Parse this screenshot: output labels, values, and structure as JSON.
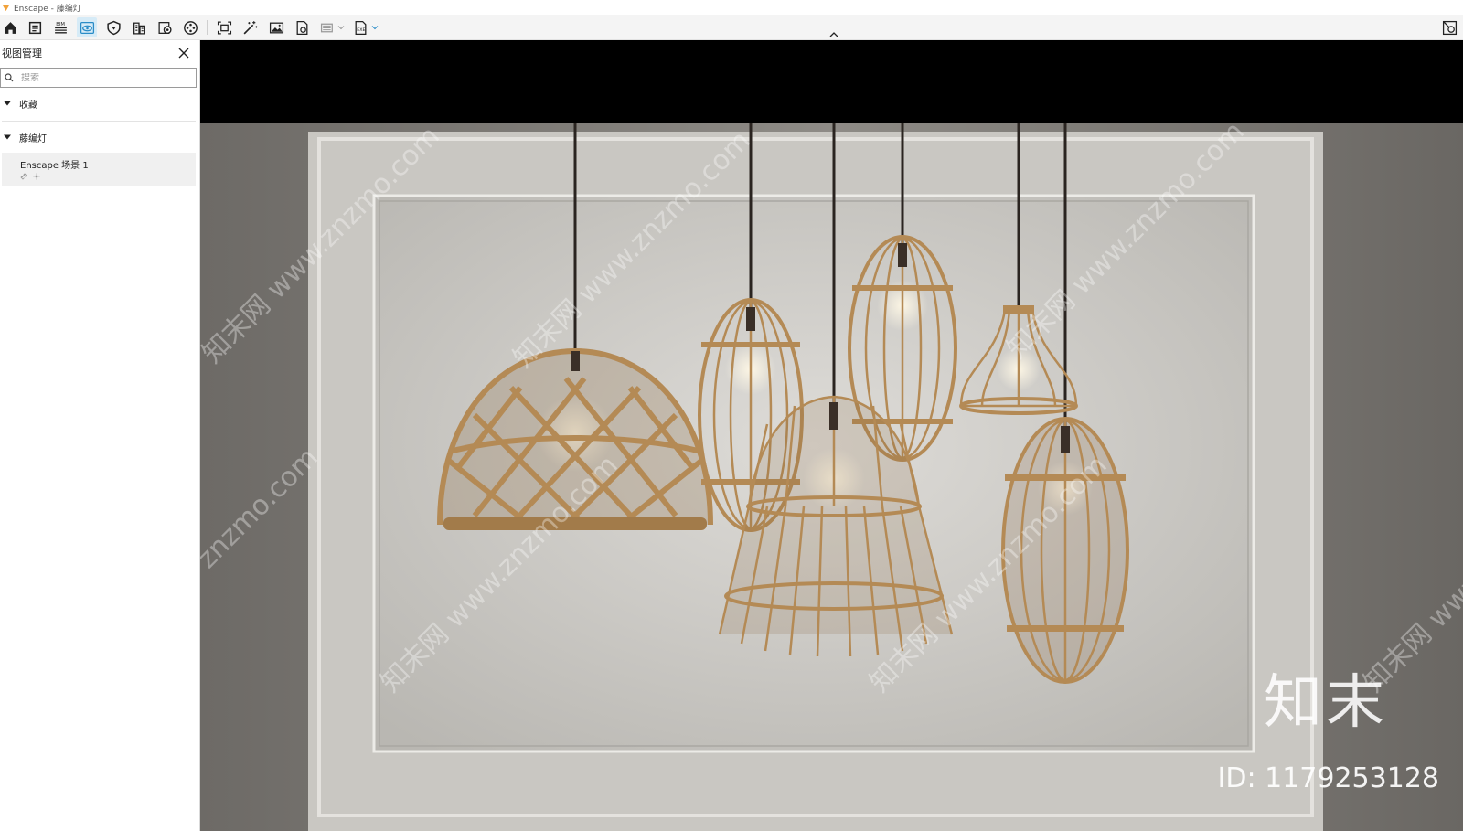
{
  "window": {
    "title": "Enscape - 藤编灯"
  },
  "toolbar": {
    "buttons": [
      "home-icon",
      "document-icon",
      "bim-icon",
      "eye-icon",
      "shield-icon",
      "building-icon",
      "camera-book-icon",
      "film-reel-icon",
      "screenshot-icon",
      "magic-wand-icon",
      "image-icon",
      "export-file-icon",
      "render-batch-icon",
      "exe-export-icon"
    ],
    "active": "eye-icon",
    "accent": "#2a8cc7"
  },
  "sidebar": {
    "title": "视图管理",
    "search_placeholder": "搜索",
    "favorites_label": "收藏",
    "group_label": "藤编灯",
    "views": [
      {
        "name": "Enscape 场景 1"
      }
    ]
  },
  "viewport": {
    "watermark_brand": "知末",
    "watermark_id": "ID: 1179253128",
    "watermark_diagonal": "知末网 www.znzmo.com",
    "watermark_diagonal_short": "znzmo.com",
    "colors": {
      "wall": "#8a8782",
      "panel": "#d6d4cf",
      "rattan": "#b48a55",
      "cord": "#2a2420"
    }
  }
}
